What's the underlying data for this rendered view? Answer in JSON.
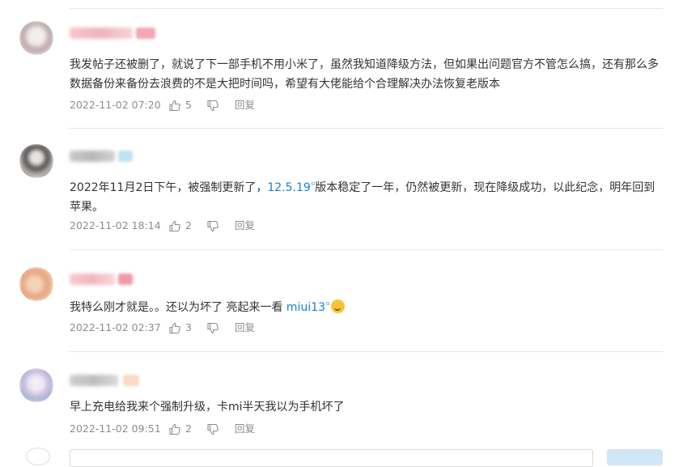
{
  "comments": [
    {
      "text": "我发帖子还被删了，就说了下一部手机不用小米了，虽然我知道降级方法，但如果出问题官方不管怎么搞，还有那么多数据备份来备份去浪费的不是大把时间吗，希望有大佬能给个合理解决办法恢复老版本",
      "time": "2022-11-02 07:20",
      "likes": "5",
      "reply_label": "回复"
    },
    {
      "text_before": "2022年11月2日下午，被强制更新了，",
      "link": "12.5.19",
      "text_after": "版本稳定了一年，仍然被更新，现在降级成功，以此纪念，明年回到苹果。",
      "time": "2022-11-02 18:14",
      "likes": "2",
      "reply_label": "回复"
    },
    {
      "text_before": "我特么刚才就是。。还以为坏了 亮起来一看 ",
      "link": "miui13",
      "time": "2022-11-02 02:37",
      "likes": "3",
      "reply_label": "回复"
    },
    {
      "text": "早上充电给我来个强制升级，卡mi半天我以为手机坏了",
      "time": "2022-11-02 09:51",
      "likes": "2",
      "reply_label": "回复"
    }
  ],
  "colors": {
    "link": "#1a7fd0",
    "meta": "#8c8c8c",
    "text": "#333333",
    "divider": "#e8e8e8"
  },
  "icons": {
    "like": "thumbs-up-icon",
    "dislike": "thumbs-down-icon",
    "link_marker": "link-icon",
    "emoji": "laughing-emoji-icon"
  }
}
